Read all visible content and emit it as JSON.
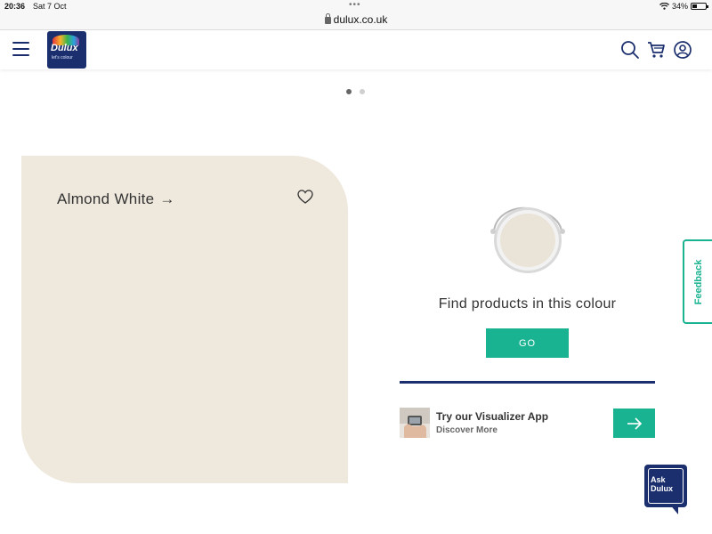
{
  "status_bar": {
    "time": "20:36",
    "date": "Sat 7 Oct",
    "more_dots": "•••",
    "battery_text": "34%",
    "battery_level": 0.34
  },
  "browser": {
    "url": "dulux.co.uk"
  },
  "header": {
    "logo_brand": "Dulux",
    "logo_tagline": "let's colour",
    "icons": [
      "menu-icon",
      "search-icon",
      "cart-icon",
      "account-icon"
    ]
  },
  "carousel": {
    "current_page": 1,
    "total_pages": 2
  },
  "colour_card": {
    "name": "Almond White",
    "arrow": "→",
    "swatch_color": "#efe8dc"
  },
  "products": {
    "heading": "Find products in this colour",
    "go_label": "GO"
  },
  "visualizer": {
    "title": "Try our Visualizer App",
    "subtitle": "Discover More"
  },
  "feedback": {
    "label": "Feedback"
  },
  "ask_dulux": {
    "line1": "Ask",
    "line2": "Dulux"
  },
  "colors": {
    "brand_navy": "#1b2f6e",
    "accent_green": "#1ab391"
  }
}
